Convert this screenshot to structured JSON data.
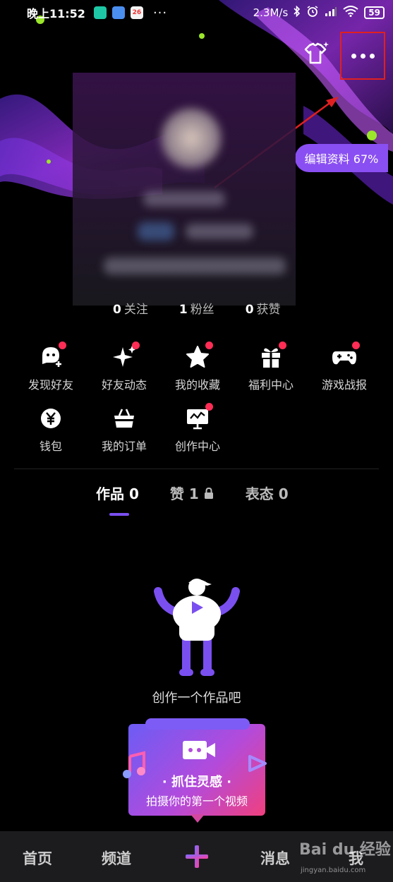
{
  "status_bar": {
    "time": "晚上11:52",
    "calendar_badge": "26",
    "more": "···",
    "network_speed": "2.3M/s",
    "battery": "59"
  },
  "header": {
    "edit_profile": "编辑资料 67%"
  },
  "stats": [
    {
      "value": "0",
      "label": "关注"
    },
    {
      "value": "1",
      "label": "粉丝"
    },
    {
      "value": "0",
      "label": "获赞"
    }
  ],
  "features": [
    {
      "label": "发现好友",
      "icon": "find-friends-icon",
      "dot": true
    },
    {
      "label": "好友动态",
      "icon": "sparkle-icon",
      "dot": true
    },
    {
      "label": "我的收藏",
      "icon": "star-icon",
      "dot": true
    },
    {
      "label": "福利中心",
      "icon": "gift-icon",
      "dot": true
    },
    {
      "label": "游戏战报",
      "icon": "gamepad-icon",
      "dot": true
    },
    {
      "label": "钱包",
      "icon": "wallet-yen-icon",
      "dot": false
    },
    {
      "label": "我的订单",
      "icon": "basket-icon",
      "dot": false
    },
    {
      "label": "创作中心",
      "icon": "creator-monitor-icon",
      "dot": true
    }
  ],
  "tabs": [
    {
      "label": "作品 0",
      "active": true
    },
    {
      "label": "赞 1",
      "locked": true
    },
    {
      "label": "表态 0"
    }
  ],
  "empty_state": {
    "text": "创作一个作品吧"
  },
  "promo": {
    "title": "· 抓住灵感 ·",
    "subtitle": "拍摄你的第一个视频"
  },
  "bottom_nav": {
    "home": "首页",
    "channel": "频道",
    "messages": "消息",
    "me": "我"
  },
  "watermark": {
    "brand": "Bai du 经验",
    "url": "jingyan.baidu.com"
  },
  "colors": {
    "accent": "#8a4ff2",
    "red_dot": "#ff2d55",
    "highlight_box": "#e02020"
  }
}
